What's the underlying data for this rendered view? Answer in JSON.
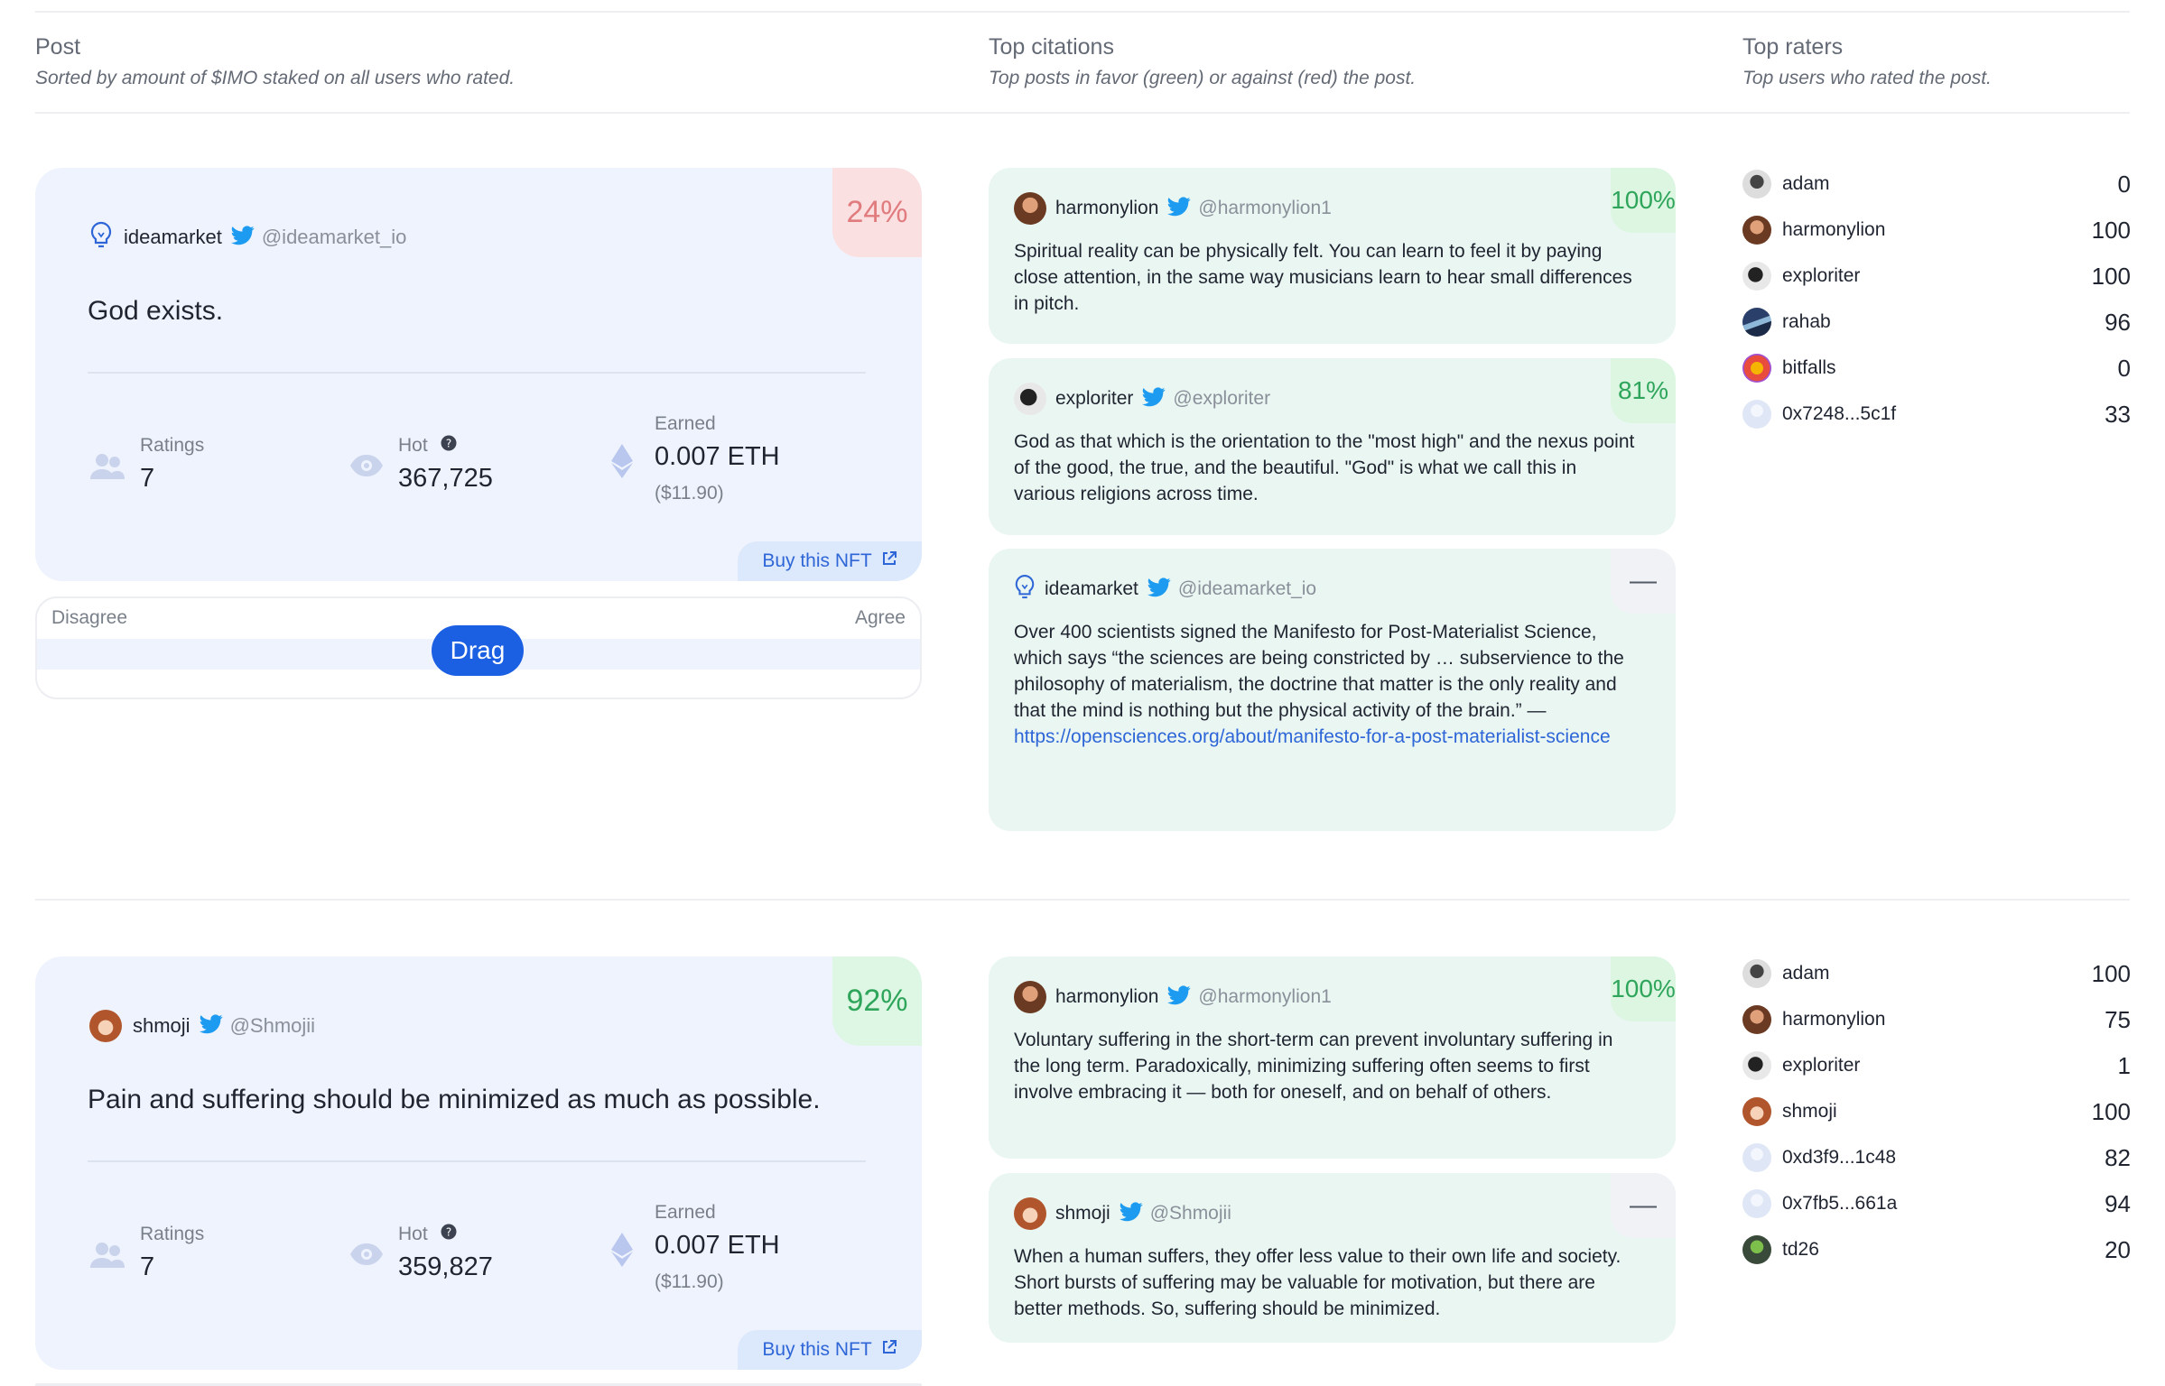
{
  "header": {
    "post_title": "Post",
    "post_sub": "Sorted by amount of $IMO staked on all users who rated.",
    "cit_title": "Top citations",
    "cit_sub": "Top posts in favor (green) or against (red) the post.",
    "raters_title": "Top raters",
    "raters_sub": "Top users who rated the post."
  },
  "labels": {
    "ratings": "Ratings",
    "hot": "Hot",
    "earned": "Earned",
    "buy": "Buy this NFT",
    "disagree": "Disagree",
    "agree": "Agree",
    "drag": "Drag"
  },
  "colors": {
    "accent": "#1b5fe3",
    "positive": "#2ea55a",
    "negative": "#e07b7e",
    "card_bg": "#eef3fd",
    "cite_bg": "#eaf6f2"
  },
  "posts": [
    {
      "author": "ideamarket",
      "handle": "@ideamarket_io",
      "avatar_icon": "lightbulb-icon",
      "text": "God exists.",
      "percent": "24%",
      "ratings": "7",
      "hot": "367,725",
      "earned": "0.007 ETH",
      "earned_usd": "($11.90)",
      "citations": [
        {
          "author": "harmonylion",
          "handle": "@harmonylion1",
          "badge": "100%",
          "text": "Spiritual reality can be physically felt. You can learn to feel it by paying close attention, in the same way musicians learn to hear small differences in pitch."
        },
        {
          "author": "exploriter",
          "handle": "@exploriter",
          "badge": "81%",
          "text": "God as that which is the orientation to the \"most high\" and the nexus point of the good, the true, and the beautiful. \"God\" is what we call this in various religions across time."
        },
        {
          "author": "ideamarket",
          "handle": "@ideamarket_io",
          "badge": "—",
          "text": "Over 400 scientists signed the Manifesto for Post-Materialist Science, which says “the sciences are being constricted by … subservience to the philosophy of materialism, the doctrine that matter is the only reality and that the mind is nothing but the physical activity of the brain.” —",
          "link": "https://opensciences.org/about/manifesto-for-a-post-materialist-science"
        }
      ],
      "raters": [
        {
          "name": "adam",
          "score": "0"
        },
        {
          "name": "harmonylion",
          "score": "100"
        },
        {
          "name": "exploriter",
          "score": "100"
        },
        {
          "name": "rahab",
          "score": "96"
        },
        {
          "name": "bitfalls",
          "score": "0"
        },
        {
          "name": "0x7248...5c1f",
          "score": "33"
        }
      ]
    },
    {
      "author": "shmoji",
      "handle": "@Shmojii",
      "avatar_icon": "avatar",
      "text": "Pain and suffering should be minimized as much as possible.",
      "percent": "92%",
      "ratings": "7",
      "hot": "359,827",
      "earned": "0.007 ETH",
      "earned_usd": "($11.90)",
      "citations": [
        {
          "author": "harmonylion",
          "handle": "@harmonylion1",
          "badge": "100%",
          "text": "Voluntary suffering in the short-term can prevent involuntary suffering in the long term. Paradoxically, minimizing suffering often seems to first involve embracing it — both for oneself, and on behalf of others."
        },
        {
          "author": "shmoji",
          "handle": "@Shmojii",
          "badge": "—",
          "text": "When a human suffers, they offer less value to their own life and society. Short bursts of suffering may be valuable for motivation, but there are better methods. So, suffering should be minimized."
        }
      ],
      "raters": [
        {
          "name": "adam",
          "score": "100"
        },
        {
          "name": "harmonylion",
          "score": "75"
        },
        {
          "name": "exploriter",
          "score": "1"
        },
        {
          "name": "shmoji",
          "score": "100"
        },
        {
          "name": "0xd3f9...1c48",
          "score": "82"
        },
        {
          "name": "0x7fb5...661a",
          "score": "94"
        },
        {
          "name": "td26",
          "score": "20"
        }
      ]
    }
  ]
}
